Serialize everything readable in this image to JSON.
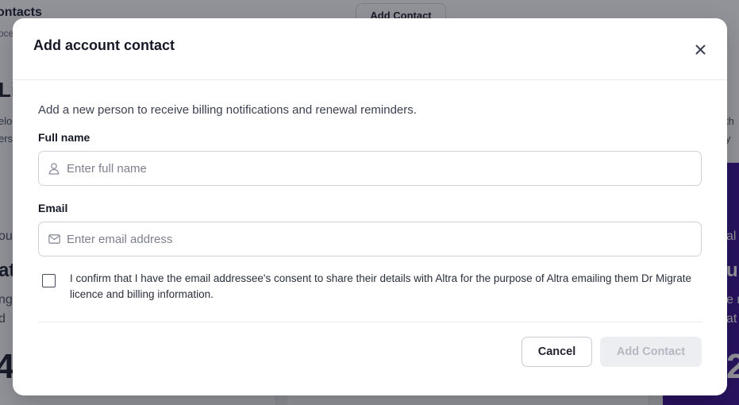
{
  "background": {
    "page_title": "ontacts",
    "page_subtitle": "oce",
    "add_contact_label": "Add Contact",
    "section_heading": "Li",
    "left_text": [
      "elo",
      "ers"
    ],
    "right_text": [
      "th",
      "y"
    ],
    "cards": [
      {
        "line1": "ou",
        "line2": "at",
        "line3": "ng",
        "line4": "d",
        "big": "4"
      },
      {
        "line1": "",
        "line2": "",
        "line3": "",
        "line4": "",
        "big": ""
      },
      {
        "line1": "al",
        "line2": "u",
        "line3": "e r",
        "line4": "at",
        "big": "2"
      }
    ]
  },
  "modal": {
    "title": "Add account contact",
    "close_icon": "close-icon",
    "intro": "Add a new person to receive billing notifications and renewal reminders.",
    "full_name": {
      "label": "Full name",
      "placeholder": "Enter full name",
      "value": "",
      "icon": "user-icon"
    },
    "email": {
      "label": "Email",
      "placeholder": "Enter email address",
      "value": "",
      "icon": "mail-icon"
    },
    "consent": {
      "checked": false,
      "text": "I confirm that I have the email addressee's consent to share their details with Altra for the purpose of Altra emailing them Dr Migrate licence and billing information."
    },
    "actions": {
      "cancel_label": "Cancel",
      "submit_label": "Add Contact",
      "submit_disabled": true
    }
  },
  "colors": {
    "overlay": "#111421",
    "accent_purple": "#3b1395",
    "disabled_bg": "#eceef1",
    "disabled_text": "#b4b8c1"
  }
}
